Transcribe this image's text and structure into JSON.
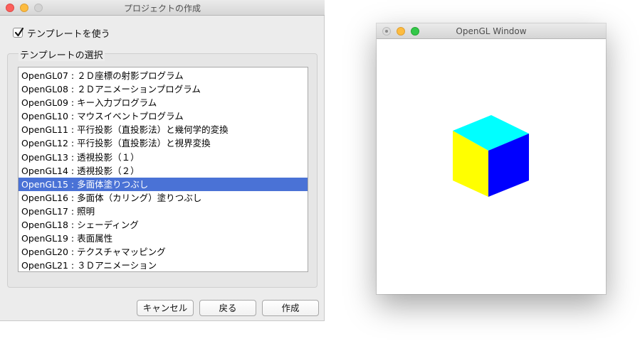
{
  "dialog": {
    "title": "プロジェクトの作成",
    "use_template_label": "テンプレートを使う",
    "use_template_checked": true,
    "group_label": "テンプレートの選択",
    "templates": [
      "OpenGL07 : ２Ｄ座標の射影プログラム",
      "OpenGL08 : ２Ｄアニメーションプログラム",
      "OpenGL09 : キー入力プログラム",
      "OpenGL10 : マウスイベントプログラム",
      "OpenGL11 : 平行投影（直投影法）と幾何学的変換",
      "OpenGL12 : 平行投影（直投影法）と視界変換",
      "OpenGL13 : 透視投影（１）",
      "OpenGL14 : 透視投影（２）",
      "OpenGL15 : 多面体塗りつぶし",
      "OpenGL16 : 多面体（カリング）塗りつぶし",
      "OpenGL17 : 照明",
      "OpenGL18 : シェーディング",
      "OpenGL19 : 表面属性",
      "OpenGL20 : テクスチャマッピング",
      "OpenGL21 : ３Ｄアニメーション"
    ],
    "selected_index": 8,
    "buttons": {
      "cancel": "キャンセル",
      "back": "戻る",
      "create": "作成"
    }
  },
  "gl_window": {
    "title": "OpenGL Window",
    "cube_colors": {
      "top": "#00ffff",
      "left": "#ffff00",
      "right": "#0000ff"
    }
  },
  "icons": {
    "checkmark": "checkmark-icon",
    "cube": "cube-icon"
  }
}
